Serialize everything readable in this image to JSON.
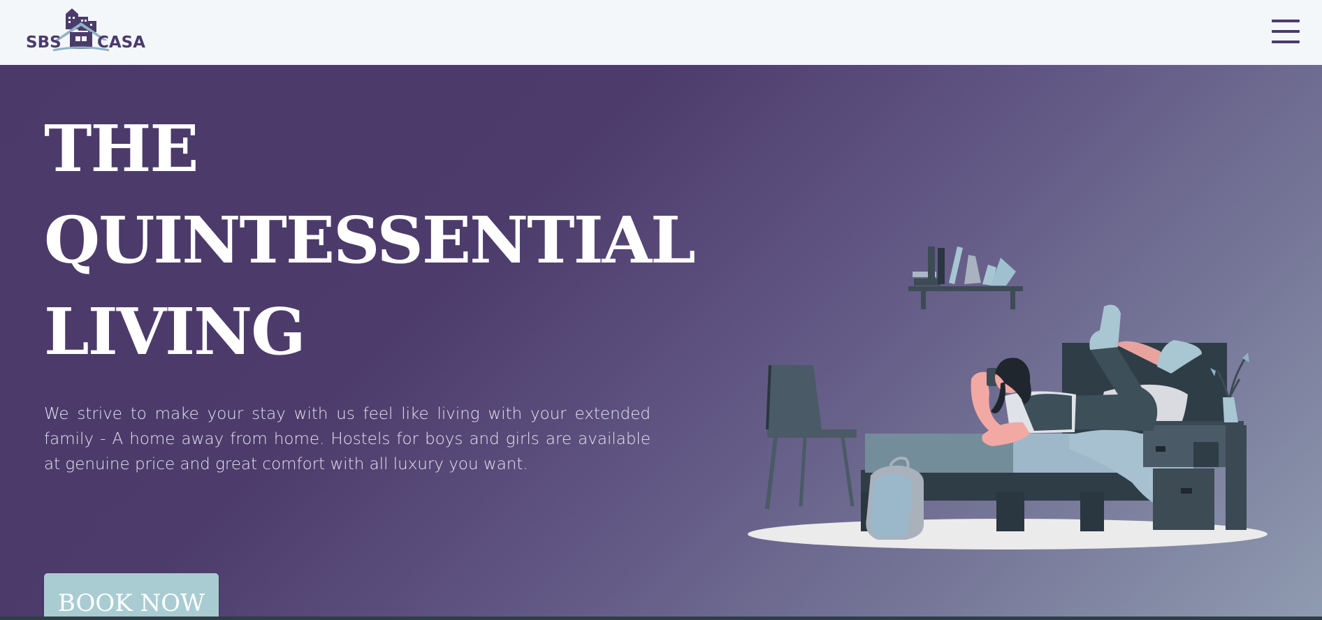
{
  "brand": {
    "left_text": "SBS",
    "right_text": "CASA",
    "primary_color": "#4b3b6b"
  },
  "nav": {
    "menu_icon": "hamburger-menu-icon"
  },
  "hero": {
    "headline_lines": [
      "THE",
      "QUINTESSENTIAL",
      "LIVING"
    ],
    "description": "We strive to make your stay with us feel like living with your extended family - A home away from home. Hostels for boys and girls are available at genuine price and great comfort with all luxury you want.",
    "cta_label": "BOOK NOW",
    "cta_color": "#a9ccd2",
    "illustration": "girl-on-bed-illustration"
  }
}
